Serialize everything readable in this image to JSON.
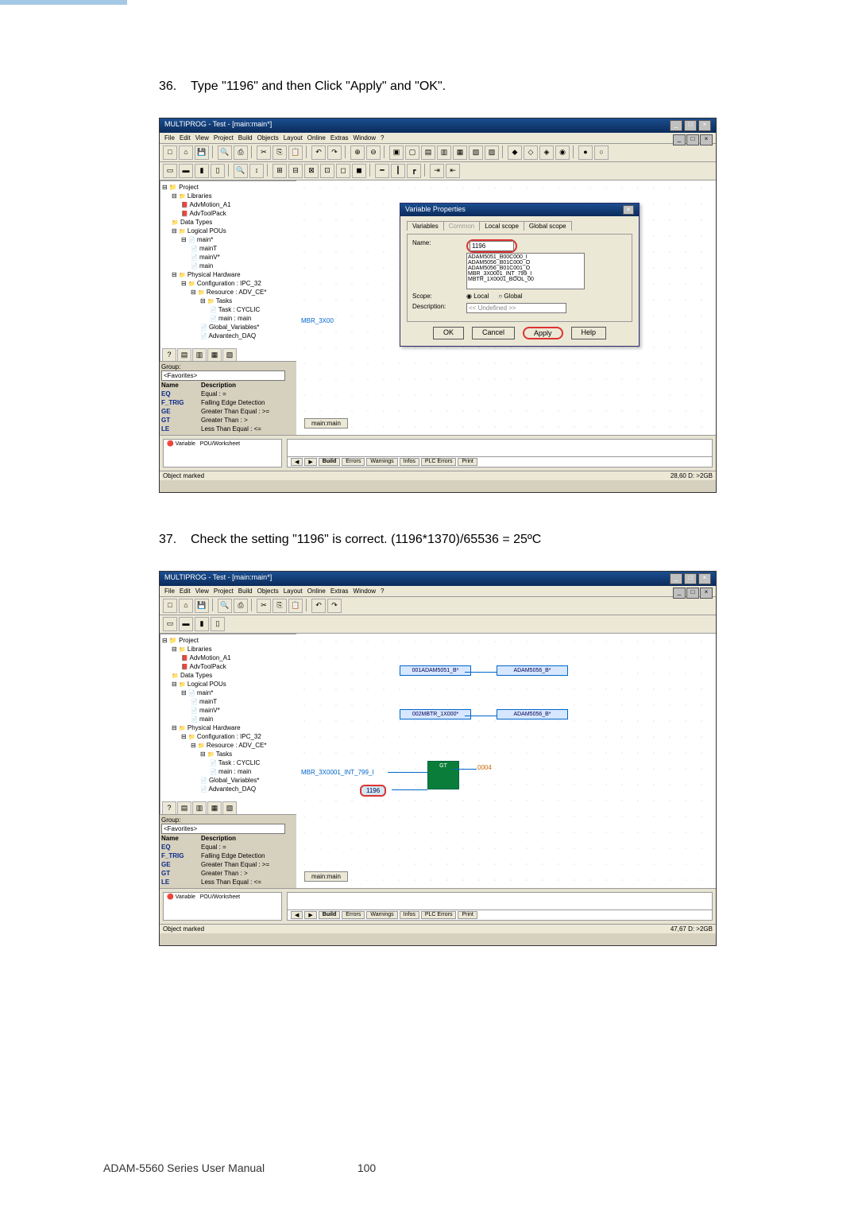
{
  "page": {
    "step36_num": "36.",
    "step36_text": "Type \"1196\" and then Click \"Apply\" and \"OK\".",
    "step37_num": "37.",
    "step37_text": "Check the setting \"1196\" is correct. (1196*1370)/65536 = 25ºC",
    "footer_left": "ADAM-5560 Series User Manual",
    "footer_page": "100"
  },
  "app": {
    "title": "MULTIPROG - Test - [main:main*]",
    "menus": [
      "File",
      "Edit",
      "View",
      "Project",
      "Build",
      "Objects",
      "Layout",
      "Online",
      "Extras",
      "Window",
      "?"
    ],
    "status_left": "Object marked",
    "status_right_1": "28,60  D: >2GB",
    "status_right_2": "47,67  D: >2GB"
  },
  "tree": {
    "root": "Project",
    "nodes": [
      {
        "l": 1,
        "ico": "folder",
        "t": "Libraries"
      },
      {
        "l": 2,
        "ico": "book",
        "t": "AdvMotion_A1"
      },
      {
        "l": 2,
        "ico": "book",
        "t": "AdvToolPack"
      },
      {
        "l": 1,
        "ico": "folder",
        "t": "Data Types"
      },
      {
        "l": 1,
        "ico": "folder",
        "t": "Logical POUs"
      },
      {
        "l": 2,
        "ico": "doc",
        "t": "main*"
      },
      {
        "l": 3,
        "ico": "doc",
        "t": "mainT"
      },
      {
        "l": 3,
        "ico": "doc",
        "t": "mainV*"
      },
      {
        "l": 3,
        "ico": "doc",
        "t": "main"
      },
      {
        "l": 1,
        "ico": "folder",
        "t": "Physical Hardware"
      },
      {
        "l": 2,
        "ico": "folder",
        "t": "Configuration : IPC_32"
      },
      {
        "l": 3,
        "ico": "folder",
        "t": "Resource : ADV_CE*"
      },
      {
        "l": 4,
        "ico": "folder",
        "t": "Tasks"
      },
      {
        "l": 5,
        "ico": "doc",
        "t": "Task : CYCLIC"
      },
      {
        "l": 5,
        "ico": "doc",
        "t": "main : main"
      },
      {
        "l": 4,
        "ico": "doc",
        "t": "Global_Variables*"
      },
      {
        "l": 4,
        "ico": "doc",
        "t": "Advantech_DAQ"
      }
    ]
  },
  "dialog": {
    "title": "Variable Properties",
    "tabs": [
      "Variables",
      "Common",
      "Local scope",
      "Global scope"
    ],
    "name_label": "Name:",
    "name_value": "1196",
    "list": [
      "ADAM5051_B00C000_I",
      "ADAM5056_B01C000_O",
      "ADAM5056_B01C001_O",
      "MBR_3X0001_INT_799_I",
      "MBTR_1X0001_BOOL_00"
    ],
    "scope_label": "Scope:",
    "scope_local": "Local",
    "scope_global": "Global",
    "desc_label": "Description:",
    "desc_value": "<< Undefined >>",
    "btn_ok": "OK",
    "btn_cancel": "Cancel",
    "btn_apply": "Apply",
    "btn_help": "Help"
  },
  "canvas1": {
    "left_label": "MBR_3X00"
  },
  "group": {
    "header": "Group:",
    "favorites": "<Favorites>",
    "cols": {
      "name": "Name",
      "desc": "Description"
    },
    "rows": [
      {
        "n": "EQ",
        "d": "Equal : ="
      },
      {
        "n": "F_TRIG",
        "d": "Falling Edge Detection"
      },
      {
        "n": "GE",
        "d": "Greater Than Equal : >="
      },
      {
        "n": "GT",
        "d": "Greater Than : >"
      },
      {
        "n": "LE",
        "d": "Less Than Equal : <="
      }
    ]
  },
  "msgs": {
    "tab": "main:main",
    "tabs_row": [
      "Build",
      "Errors",
      "Warnings",
      "Infos",
      "PLC Errors",
      "Print"
    ],
    "var_label": "Variable",
    "pou_label": "POU/Worksheet"
  },
  "canvas2": {
    "b1": "001ADAM5051_B*",
    "b1r": "ADAM5056_B*",
    "b2": "002MBTR_1X000*",
    "b2r": "ADAM5056_B*",
    "gt": "GT",
    "gt_out": "0004",
    "left_var": "MBR_3X0001_INT_799_I",
    "literal": "1196"
  }
}
